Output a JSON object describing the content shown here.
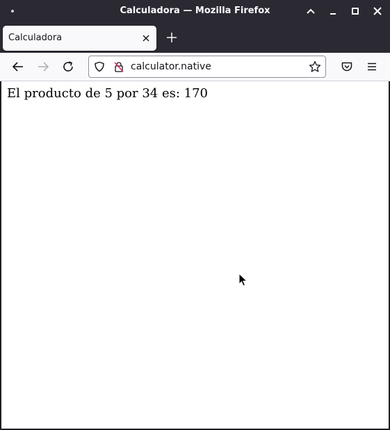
{
  "window": {
    "title": "Calculadora — Mozilla Firefox"
  },
  "tabs": [
    {
      "label": "Calculadora",
      "active": true
    }
  ],
  "navbar": {
    "url": "calculator.native"
  },
  "page": {
    "result_text": "El producto de 5 por 34 es: 170"
  },
  "icons": {
    "back": "back-arrow-icon",
    "forward": "forward-arrow-icon",
    "reload": "reload-icon",
    "shield": "shield-icon",
    "insecure": "insecure-lock-icon",
    "bookmark": "star-icon",
    "pocket": "pocket-icon",
    "menu": "hamburger-menu-icon"
  },
  "colors": {
    "chrome_dark": "#2b2a33",
    "toolbar": "#f9f9fb",
    "insecure_slash": "#e22850"
  }
}
